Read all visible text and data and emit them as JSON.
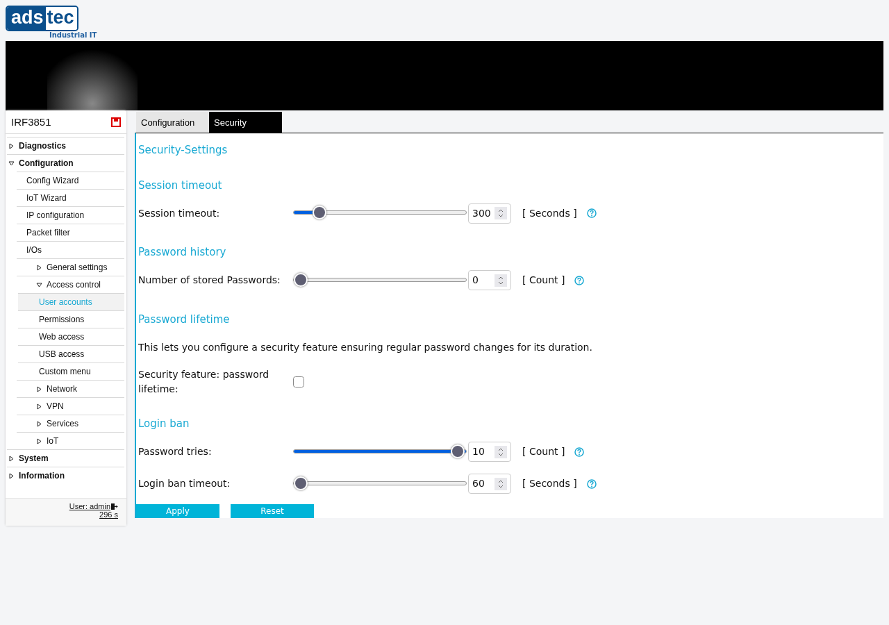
{
  "logo": {
    "left": "ads",
    "right": "tec",
    "tagline": "Industrial IT"
  },
  "sidebar": {
    "device": "IRF3851",
    "items": [
      {
        "label": "Diagnostics",
        "expanded": false
      },
      {
        "label": "Configuration",
        "expanded": true,
        "children": [
          {
            "label": "Config Wizard"
          },
          {
            "label": "IoT Wizard"
          },
          {
            "label": "IP configuration"
          },
          {
            "label": "Packet filter"
          },
          {
            "label": "I/Os",
            "children": [
              {
                "label": "General settings",
                "expanded": false
              },
              {
                "label": "Access control",
                "expanded": true,
                "children": [
                  {
                    "label": "User accounts",
                    "selected": true
                  },
                  {
                    "label": "Permissions",
                    "selected": false
                  },
                  {
                    "label": "Web access",
                    "selected": false
                  },
                  {
                    "label": "USB access",
                    "selected": false
                  },
                  {
                    "label": "Custom menu",
                    "selected": false
                  }
                ]
              },
              {
                "label": "Network",
                "expanded": false
              },
              {
                "label": "VPN",
                "expanded": false
              },
              {
                "label": "Services",
                "expanded": false
              },
              {
                "label": "IoT",
                "expanded": false
              }
            ]
          }
        ]
      },
      {
        "label": "System",
        "expanded": false
      },
      {
        "label": "Information",
        "expanded": false
      }
    ],
    "user": "User: admin",
    "timer": "296 s"
  },
  "tabs": [
    {
      "label": "Configuration",
      "selected": false
    },
    {
      "label": "Security",
      "selected": true
    }
  ],
  "title": "Security-Settings",
  "sections": [
    {
      "heading": "Session timeout",
      "rows": [
        {
          "kind": "slider",
          "label": "Session timeout:",
          "level": 0.12,
          "value": "300",
          "unit": "[ Seconds ]"
        }
      ]
    },
    {
      "heading": "Password history",
      "rows": [
        {
          "kind": "slider",
          "label": "Number of stored Passwords:",
          "level": 0,
          "value": "0",
          "unit": "[ Count ]"
        }
      ]
    },
    {
      "heading": "Password lifetime",
      "rows": [
        {
          "kind": "text",
          "text": "This lets you configure a security feature ensuring regular password changes for its duration."
        },
        {
          "kind": "checkbox",
          "label": "Security feature: password lifetime:",
          "checked": false
        }
      ]
    },
    {
      "heading": "Login ban",
      "rows": [
        {
          "kind": "slider",
          "label": "Password tries:",
          "level": 1,
          "value": "10",
          "unit": "[ Count ]"
        },
        {
          "kind": "slider",
          "label": "Login ban timeout:",
          "level": 0,
          "value": "60",
          "unit": "[ Seconds ]"
        }
      ]
    }
  ],
  "buttons": [
    "Apply",
    "Reset"
  ]
}
